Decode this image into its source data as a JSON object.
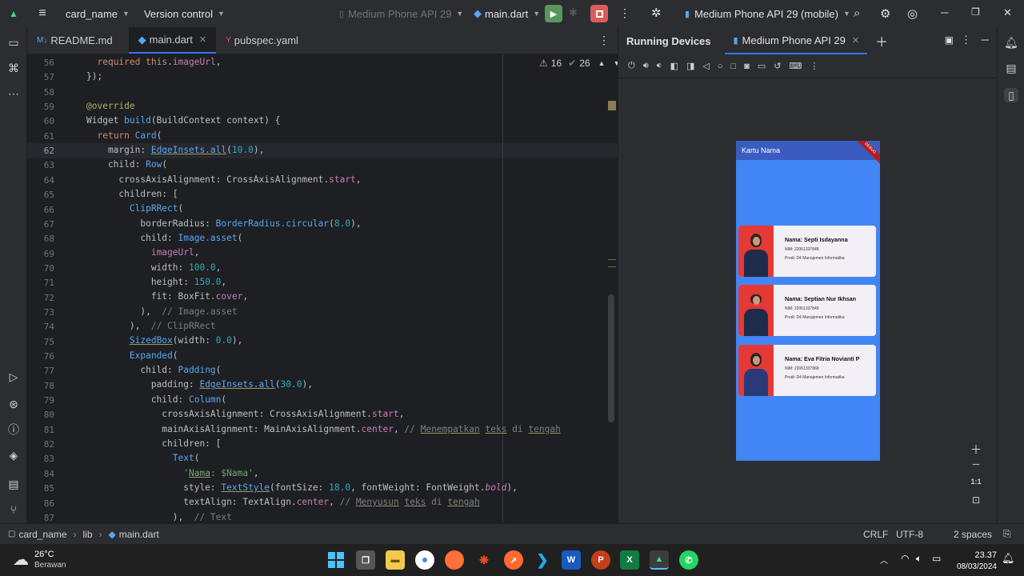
{
  "titlebar": {
    "project": "card_name",
    "vcs": "Version control",
    "device_disabled": "Medium Phone API 29",
    "run_config": "main.dart",
    "device_selector": "Medium Phone API 29 (mobile)"
  },
  "editor_tabs": [
    {
      "label": "README.md",
      "icon": "markdown-icon"
    },
    {
      "label": "main.dart",
      "icon": "dart-icon",
      "active": true
    },
    {
      "label": "pubspec.yaml",
      "icon": "yaml-icon"
    }
  ],
  "inspection": {
    "warnings": "16",
    "ok": "26"
  },
  "line_numbers": [
    "56",
    "57",
    "58",
    "59",
    "60",
    "61",
    "62",
    "63",
    "64",
    "65",
    "66",
    "67",
    "68",
    "69",
    "70",
    "71",
    "72",
    "73",
    "74",
    "75",
    "76",
    "77",
    "78",
    "79",
    "80",
    "81",
    "82",
    "83",
    "84",
    "85",
    "86",
    "87"
  ],
  "devices_panel": {
    "title": "Running Devices",
    "device_tab": "Medium Phone API 29"
  },
  "phone": {
    "appbar_title": "Kartu Nama",
    "debug_banner": "DEBUG",
    "cards": [
      {
        "name": "Nama: Septi Isdayanna",
        "nim": "NIM: 22061337848",
        "prodi": "Prodi: D4 Manajemen Informatika"
      },
      {
        "name": "Nama: Septian Nur Ikhsan",
        "nim": "NIM: 22061337849",
        "prodi": "Prodi: D4 Manajemen Informatika"
      },
      {
        "name": "Nama: Eva Fitria Novianti P",
        "nim": "NIM: 22061337868",
        "prodi": "Prodi: D4 Manajemen Informatika"
      }
    ]
  },
  "zoom": {
    "ratio": "1:1"
  },
  "statusbar": {
    "breadcrumb": [
      "card_name",
      "lib",
      "main.dart"
    ],
    "line_ending": "CRLF",
    "encoding": "UTF-8",
    "indent": "2 spaces"
  },
  "taskbar": {
    "temperature": "26°C",
    "weather": "Berawan",
    "time": "23.37",
    "date": "08/03/2024"
  },
  "colors": {
    "accent": "#3574f0",
    "run_green": "#57965c",
    "stop_red": "#db5c5c",
    "phone_bg": "#4285f4"
  }
}
